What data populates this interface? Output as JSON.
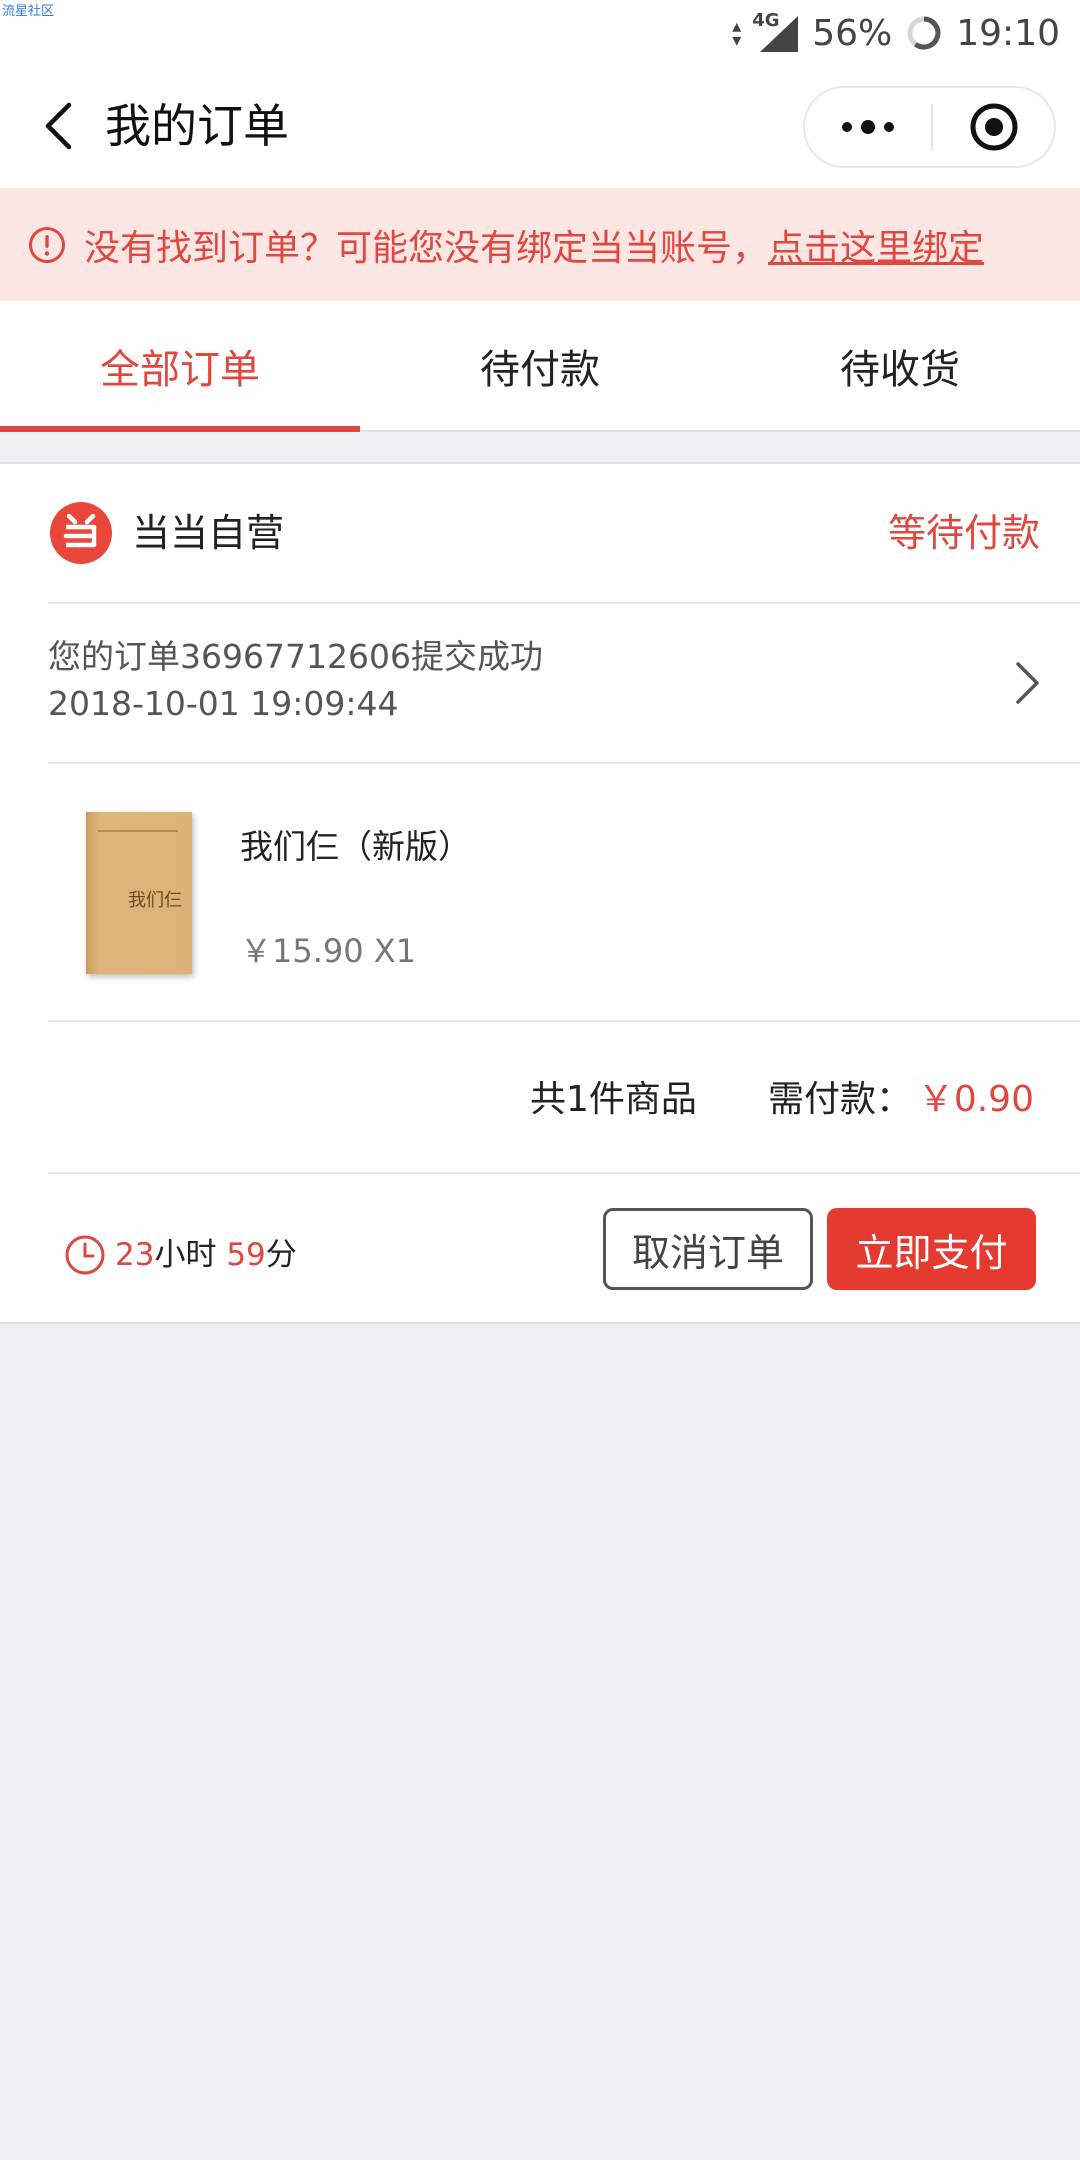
{
  "status_bar": {
    "watermark": "流星社区",
    "network": "4G",
    "battery_percent": "56%",
    "time": "19:10"
  },
  "nav": {
    "title": "我的订单",
    "back_icon": "chevron-left-icon",
    "more_icon": "more-dots-icon",
    "target_icon": "target-icon"
  },
  "notice": {
    "text": "没有找到订单？可能您没有绑定当当账号，",
    "link": "点击这里绑定"
  },
  "tabs": [
    {
      "label": "全部订单",
      "active": true
    },
    {
      "label": "待付款",
      "active": false
    },
    {
      "label": "待收货",
      "active": false
    }
  ],
  "order": {
    "shop_name": "当当自营",
    "status": "等待付款",
    "info_line": "您的订单36967712606提交成功",
    "datetime": "2018-10-01 19:09:44",
    "item": {
      "name": "我们仨（新版）",
      "price_qty": "￥15.90 X1",
      "cover_title": "我们仨"
    },
    "summary": {
      "count": "共1件商品",
      "pay_label": "需付款：",
      "pay_amount": "￥0.90"
    },
    "countdown": {
      "hours": "23",
      "hours_unit": "小时",
      "minutes": "59",
      "minutes_unit": "分"
    },
    "cancel_label": "取消订单",
    "pay_label": "立即支付"
  },
  "colors": {
    "accent": "#e0473f",
    "pay_button": "#e53a30",
    "notice_bg": "#fbe6e3",
    "page_bg": "#efeff4"
  }
}
